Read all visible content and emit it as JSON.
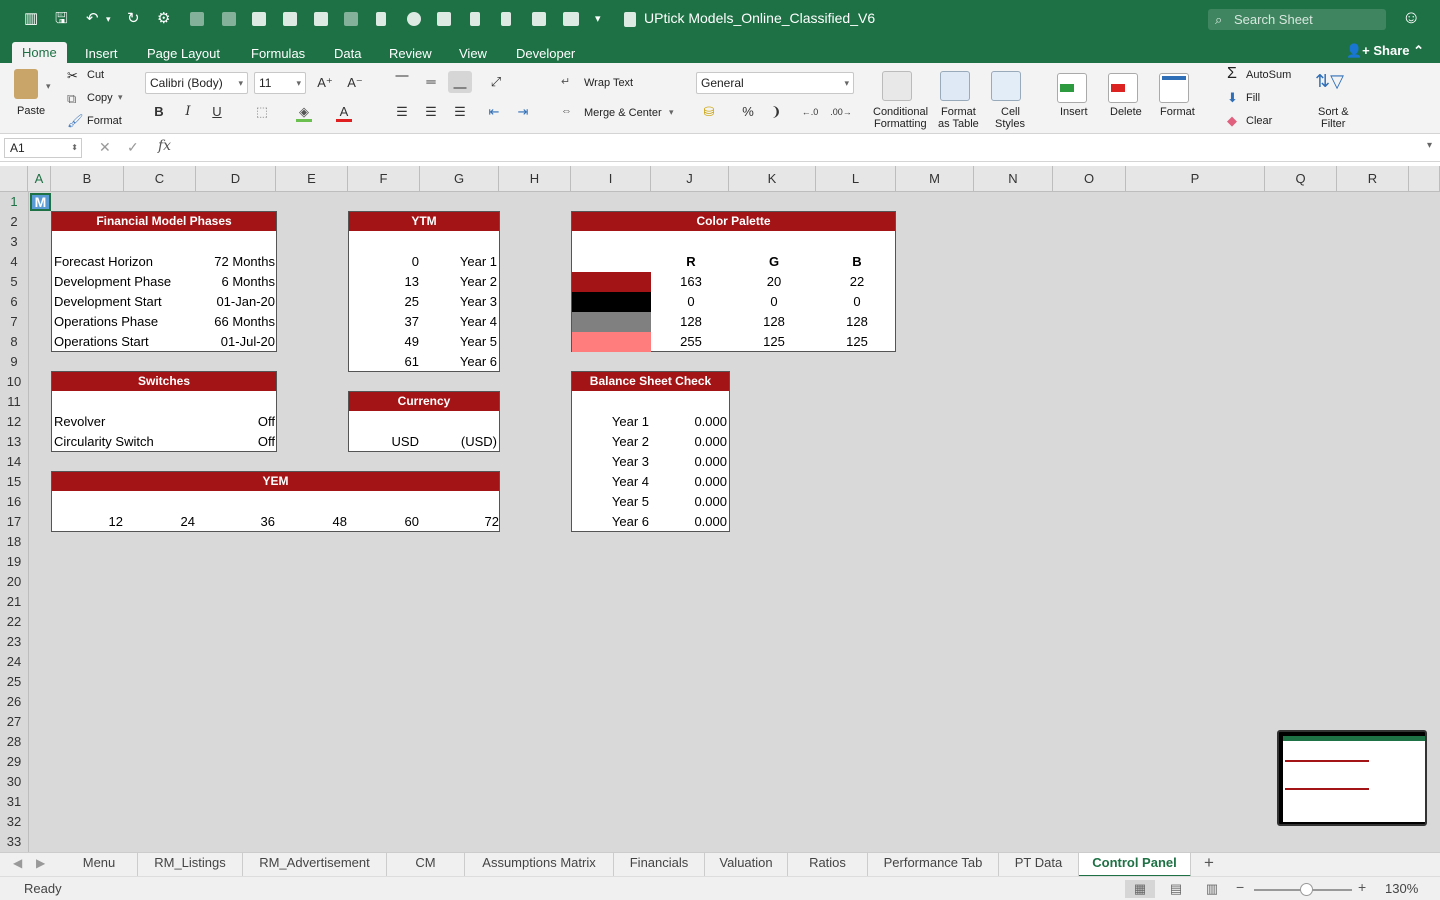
{
  "app": {
    "title": "UPtick Models_Online_Classified_V6",
    "search_placeholder": "Search Sheet",
    "share_label": "Share",
    "accent": "#1e7145",
    "header_red": "#a31416"
  },
  "ribbon_tabs": [
    "Home",
    "Insert",
    "Page Layout",
    "Formulas",
    "Data",
    "Review",
    "View",
    "Developer"
  ],
  "ribbon": {
    "paste": "Paste",
    "cut": "Cut",
    "copy": "Copy",
    "format_painter": "Format",
    "font_name": "Calibri (Body)",
    "font_size": "11",
    "bold": "B",
    "italic": "I",
    "underline": "U",
    "wrap_text": "Wrap Text",
    "merge_center": "Merge & Center",
    "number_format": "General",
    "percent": "%",
    "conditional_formatting_1": "Conditional",
    "conditional_formatting_2": "Formatting",
    "format_table_1": "Format",
    "format_table_2": "as Table",
    "cell_styles_1": "Cell",
    "cell_styles_2": "Styles",
    "insert": "Insert",
    "delete": "Delete",
    "format": "Format",
    "autosum": "AutoSum",
    "fill": "Fill",
    "clear": "Clear",
    "sort_filter_1": "Sort &",
    "sort_filter_2": "Filter"
  },
  "formula_bar": {
    "name_box": "A1",
    "fx": "fx",
    "content": ""
  },
  "columns": [
    "A",
    "B",
    "C",
    "D",
    "E",
    "F",
    "G",
    "H",
    "I",
    "J",
    "K",
    "L",
    "M",
    "N",
    "O",
    "P",
    "Q",
    "R"
  ],
  "rows": [
    "1",
    "2",
    "3",
    "4",
    "5",
    "6",
    "7",
    "8",
    "9",
    "10",
    "11",
    "12",
    "13",
    "14",
    "15",
    "16",
    "17",
    "18",
    "19",
    "20",
    "21",
    "22",
    "23",
    "24",
    "25",
    "26",
    "27",
    "28",
    "29",
    "30",
    "31",
    "32",
    "33"
  ],
  "a1_value": "M",
  "phases": {
    "title": "Financial Model Phases",
    "rows": [
      {
        "label": "Forecast Horizon",
        "value": "72 Months"
      },
      {
        "label": "Development Phase",
        "value": "6 Months"
      },
      {
        "label": "Development Start",
        "value": "01-Jan-20"
      },
      {
        "label": "Operations Phase",
        "value": "66 Months"
      },
      {
        "label": "Operations Start",
        "value": "01-Jul-20"
      }
    ]
  },
  "switches": {
    "title": "Switches",
    "rows": [
      {
        "label": "Revolver",
        "value": "Off"
      },
      {
        "label": "Circularity Switch",
        "value": "Off"
      }
    ]
  },
  "ytm": {
    "title": "YTM",
    "rows": [
      {
        "num": "0",
        "year": "Year 1"
      },
      {
        "num": "13",
        "year": "Year 2"
      },
      {
        "num": "25",
        "year": "Year 3"
      },
      {
        "num": "37",
        "year": "Year 4"
      },
      {
        "num": "49",
        "year": "Year 5"
      },
      {
        "num": "61",
        "year": "Year 6"
      }
    ]
  },
  "currency": {
    "title": "Currency",
    "code": "USD",
    "symbol": "(USD)"
  },
  "yem": {
    "title": "YEM",
    "values": [
      "12",
      "24",
      "36",
      "48",
      "60",
      "72"
    ]
  },
  "palette": {
    "title": "Color Palette",
    "headers": [
      "R",
      "G",
      "B"
    ],
    "rows": [
      {
        "color": "#a31416",
        "r": "163",
        "g": "20",
        "b": "22"
      },
      {
        "color": "#000000",
        "r": "0",
        "g": "0",
        "b": "0"
      },
      {
        "color": "#808080",
        "r": "128",
        "g": "128",
        "b": "128"
      },
      {
        "color": "#ff7d7d",
        "r": "255",
        "g": "125",
        "b": "125"
      }
    ]
  },
  "balance": {
    "title": "Balance Sheet Check",
    "rows": [
      {
        "year": "Year 1",
        "value": "0.000"
      },
      {
        "year": "Year 2",
        "value": "0.000"
      },
      {
        "year": "Year 3",
        "value": "0.000"
      },
      {
        "year": "Year 4",
        "value": "0.000"
      },
      {
        "year": "Year 5",
        "value": "0.000"
      },
      {
        "year": "Year 6",
        "value": "0.000"
      }
    ]
  },
  "sheet_tabs": [
    "Menu",
    "RM_Listings",
    "RM_Advertisement",
    "CM",
    "Assumptions Matrix",
    "Financials",
    "Valuation",
    "Ratios",
    "Performance Tab",
    "PT Data",
    "Control Panel"
  ],
  "active_sheet": "Control Panel",
  "status": {
    "text": "Ready",
    "zoom": "130%"
  }
}
